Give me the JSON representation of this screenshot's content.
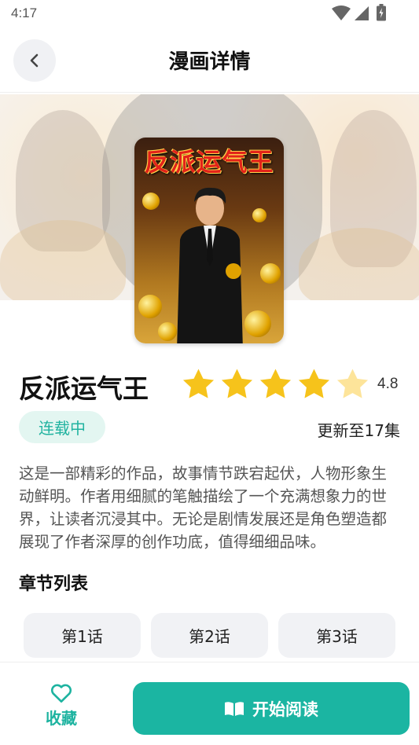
{
  "status_bar": {
    "time": "4:17"
  },
  "header": {
    "title": "漫画详情"
  },
  "cover": {
    "title_art": "反派运气王"
  },
  "comic": {
    "title": "反派运气王",
    "rating": 4.8,
    "rating_text": "4.8",
    "status": "连载中",
    "update": "更新至17集",
    "description": "这是一部精彩的作品，故事情节跌宕起伏，人物形象生动鲜明。作者用细腻的笔触描绘了一个充满想象力的世界，让读者沉浸其中。无论是剧情发展还是角色塑造都展现了作者深厚的创作功底，值得细细品味。"
  },
  "chapters": {
    "section_title": "章节列表",
    "items": [
      {
        "label": "第1话"
      },
      {
        "label": "第2话"
      },
      {
        "label": "第3话"
      }
    ]
  },
  "bottom_bar": {
    "favorite_label": "收藏",
    "favorite_icon": "heart-outline-icon",
    "read_label": "开始阅读",
    "read_icon": "open-book-icon"
  },
  "colors": {
    "accent": "#1bb5a2",
    "star": "#f6c31b",
    "star_empty": "#fde49a"
  }
}
